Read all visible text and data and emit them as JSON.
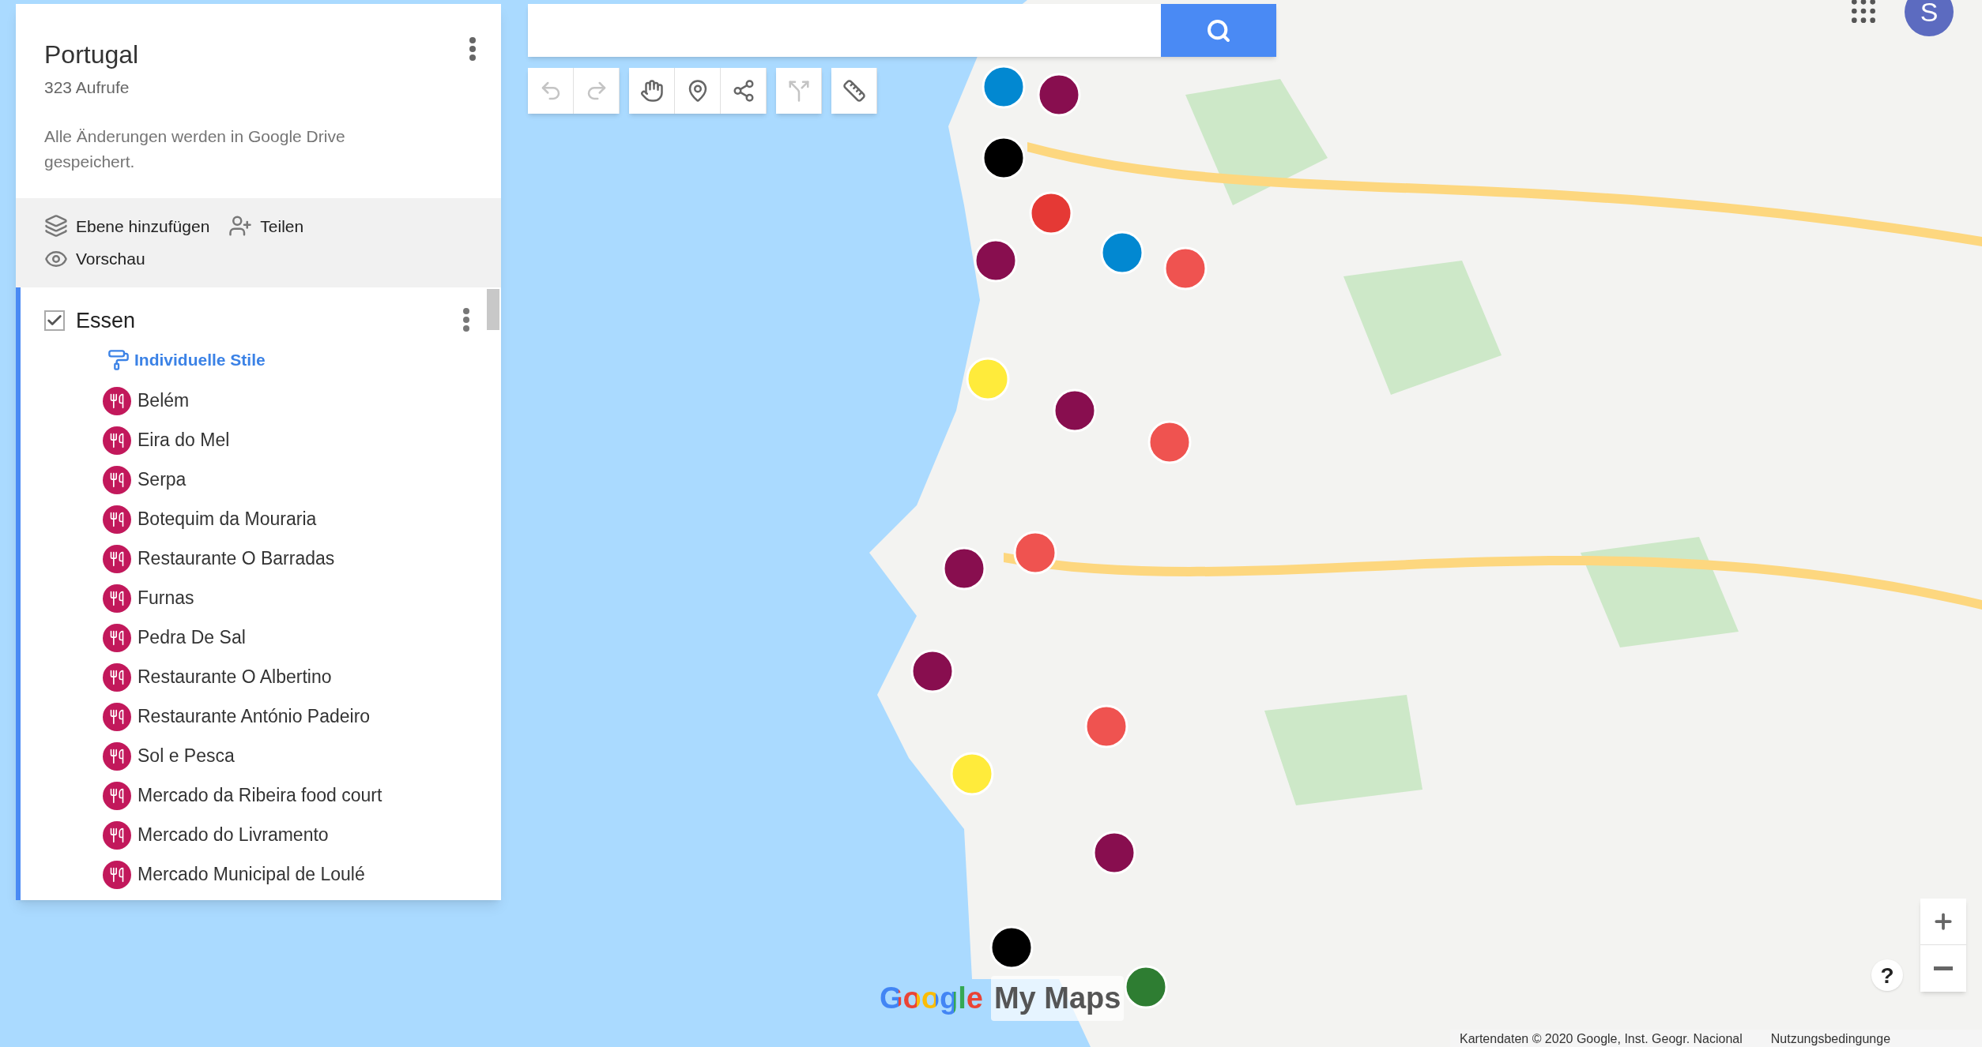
{
  "panel": {
    "title": "Portugal",
    "views": "323 Aufrufe",
    "save_notice": "Alle Änderungen werden in Google Drive gespeichert.",
    "actions": [
      {
        "kind": "layers",
        "label": "Ebene hinzufügen"
      },
      {
        "kind": "share",
        "label": "Teilen"
      },
      {
        "kind": "preview",
        "label": "Vorschau"
      }
    ]
  },
  "layer": {
    "name": "Essen",
    "checked": true,
    "style_link": "Individuelle Stile",
    "places": [
      {
        "name": "Belém",
        "color": "#c2185b"
      },
      {
        "name": "Eira do Mel",
        "color": "#c2185b"
      },
      {
        "name": "Serpa",
        "color": "#c2185b"
      },
      {
        "name": "Botequim da Mouraria",
        "color": "#c2185b"
      },
      {
        "name": "Restaurante O Barradas",
        "color": "#c2185b"
      },
      {
        "name": "Furnas",
        "color": "#c2185b"
      },
      {
        "name": "Pedra De Sal",
        "color": "#c2185b"
      },
      {
        "name": "Restaurante O Albertino",
        "color": "#c2185b"
      },
      {
        "name": "Restaurante António Padeiro",
        "color": "#c2185b"
      },
      {
        "name": "Sol e Pesca",
        "color": "#c2185b"
      },
      {
        "name": "Mercado da Ribeira food court",
        "color": "#c2185b"
      },
      {
        "name": "Mercado do Livramento",
        "color": "#c2185b"
      },
      {
        "name": "Mercado Municipal de Loulé",
        "color": "#c2185b"
      }
    ]
  },
  "toolbar": [
    [
      {
        "kind": "undo",
        "disabled": true
      },
      {
        "kind": "redo",
        "disabled": true
      }
    ],
    [
      {
        "kind": "hand",
        "disabled": false
      },
      {
        "kind": "marker",
        "disabled": false
      },
      {
        "kind": "line",
        "disabled": false
      }
    ],
    [
      {
        "kind": "route",
        "disabled": true
      }
    ],
    [
      {
        "kind": "ruler",
        "disabled": false
      }
    ]
  ],
  "map": {
    "logo": {
      "google": "Google",
      "product": "My Maps"
    },
    "help": "?",
    "attribution": "Kartendaten © 2020 Google, Inst. Geogr. Nacional",
    "terms": "Nutzungsbedingunge"
  },
  "account": {
    "initial": "S"
  }
}
